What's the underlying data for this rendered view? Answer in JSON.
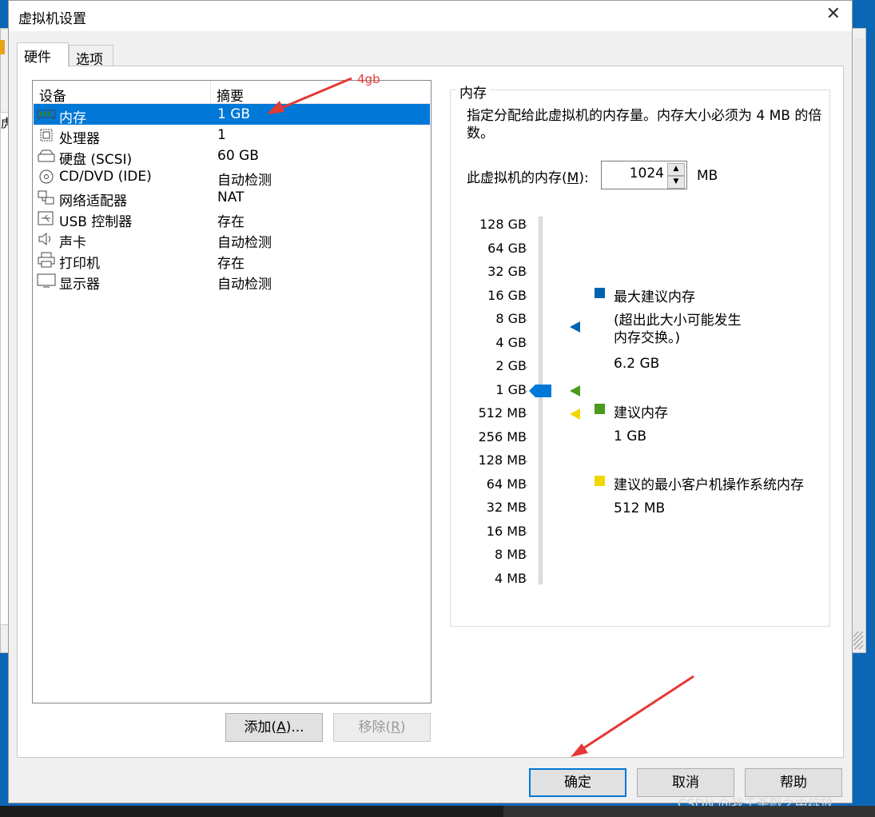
{
  "dialog": {
    "title": "虚拟机设置"
  },
  "tabs": [
    {
      "label": "硬件"
    },
    {
      "label": "选项"
    }
  ],
  "background": {
    "left_text": "虎"
  },
  "device_list": {
    "headers": {
      "device": "设备",
      "summary": "摘要"
    },
    "rows": [
      {
        "name": "内存",
        "summary": "1 GB",
        "icon": "memory-icon",
        "selected": true
      },
      {
        "name": "处理器",
        "summary": "1",
        "icon": "cpu-icon"
      },
      {
        "name": "硬盘 (SCSI)",
        "summary": "60 GB",
        "icon": "hard-disk-icon"
      },
      {
        "name": "CD/DVD (IDE)",
        "summary": "自动检测",
        "icon": "cd-dvd-icon"
      },
      {
        "name": "网络适配器",
        "summary": "NAT",
        "icon": "network-adapter-icon"
      },
      {
        "name": "USB 控制器",
        "summary": "存在",
        "icon": "usb-icon"
      },
      {
        "name": "声卡",
        "summary": "自动检测",
        "icon": "speaker-icon"
      },
      {
        "name": "打印机",
        "summary": "存在",
        "icon": "printer-icon"
      },
      {
        "name": "显示器",
        "summary": "自动检测",
        "icon": "monitor-icon"
      }
    ]
  },
  "buttons": {
    "add": {
      "label": "添加(A)...",
      "mnemonic": "A"
    },
    "remove": {
      "label": "移除(R)",
      "mnemonic": "R"
    },
    "ok": "确定",
    "cancel": "取消",
    "help": "帮助"
  },
  "memory": {
    "group_title": "内存",
    "description": "指定分配给此虚拟机的内存量。内存大小必须为 4 MB 的倍数。",
    "label": "此虚拟机的内存(M):",
    "label_mnemonic": "M",
    "value": "1024",
    "unit": "MB",
    "scale": [
      "128 GB",
      "64 GB",
      "32 GB",
      "16 GB",
      "8 GB",
      "4 GB",
      "2 GB",
      "1 GB",
      "512 MB",
      "256 MB",
      "128 MB",
      "64 MB",
      "32 MB",
      "16 MB",
      "8 MB",
      "4 MB"
    ],
    "current_index": 7,
    "max_recommended_index": 4.3,
    "recommended_index": 7,
    "min_guest_index": 8,
    "legend": {
      "max": {
        "title": "最大建议内存",
        "note": "(超出此大小可能发生内存交换。)",
        "value": "6.2 GB",
        "color": "#0063b1"
      },
      "rec": {
        "title": "建议内存",
        "value": "1 GB",
        "color": "#4a9a1c"
      },
      "min": {
        "title": "建议的最小客户机操作系统内存",
        "value": "512 MB",
        "color": "#f2d600"
      }
    }
  },
  "annotation": {
    "text": "4gb"
  },
  "watermark": "CSDN @我于杀戮之中绽放"
}
